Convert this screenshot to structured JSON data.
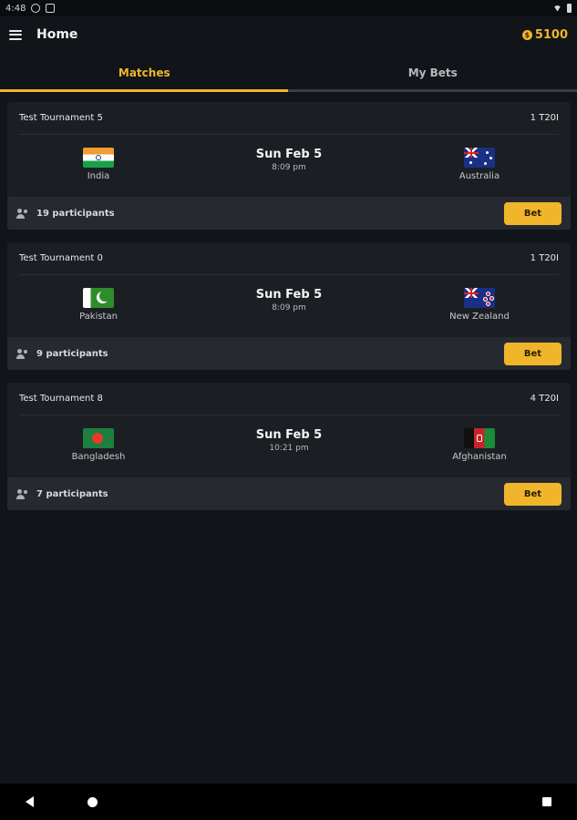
{
  "status_bar": {
    "time": "4:48"
  },
  "header": {
    "title": "Home",
    "coins": "5100"
  },
  "tabs": [
    {
      "label": "Matches",
      "active": true
    },
    {
      "label": "My Bets",
      "active": false
    }
  ],
  "colors": {
    "accent": "#f0b52a",
    "background": "#111418",
    "card": "#1b1e23",
    "card_footer": "#262a30"
  },
  "matches": [
    {
      "tournament": "Test Tournament 5",
      "format": "1 T20I",
      "home": {
        "name": "India",
        "flag": "india-flag-icon"
      },
      "away": {
        "name": "Australia",
        "flag": "australia-flag-icon"
      },
      "date": "Sun Feb 5",
      "time": "8:09 pm",
      "participants": "19 participants",
      "bet_label": "Bet"
    },
    {
      "tournament": "Test Tournament 0",
      "format": "1 T20I",
      "home": {
        "name": "Pakistan",
        "flag": "pakistan-flag-icon"
      },
      "away": {
        "name": "New Zealand",
        "flag": "new-zealand-flag-icon"
      },
      "date": "Sun Feb 5",
      "time": "8:09 pm",
      "participants": "9 participants",
      "bet_label": "Bet"
    },
    {
      "tournament": "Test Tournament 8",
      "format": "4 T20I",
      "home": {
        "name": "Bangladesh",
        "flag": "bangladesh-flag-icon"
      },
      "away": {
        "name": "Afghanistan",
        "flag": "afghanistan-flag-icon"
      },
      "date": "Sun Feb 5",
      "time": "10:21 pm",
      "participants": "7 participants",
      "bet_label": "Bet"
    }
  ]
}
